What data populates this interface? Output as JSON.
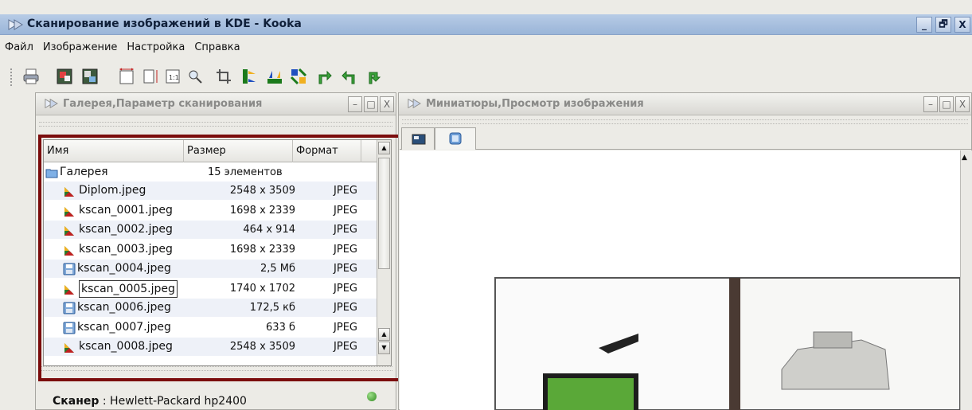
{
  "window": {
    "title": "Сканирование изображений в KDE - Kooka",
    "btn_min": "_",
    "btn_max": "🗗",
    "btn_close": "X"
  },
  "menu": {
    "file": "Файл",
    "image": "Изображение",
    "settings": "Настройка",
    "help": "Справка"
  },
  "toolbar_icons": [
    "print-icon",
    "scan-icon",
    "scan-preview-icon",
    "fit-width-icon",
    "fit-height-icon",
    "original-size-icon",
    "zoom-icon",
    "crop-icon",
    "mirror-vertical-icon",
    "mirror-horizontal-icon",
    "mirror-both-icon",
    "rotate-cw-icon",
    "rotate-ccw-icon",
    "rotate-180-icon"
  ],
  "left_panel": {
    "title": "Галерея,Параметр сканирования",
    "btn_min": "–",
    "btn_max": "□",
    "btn_close": "X"
  },
  "right_panel": {
    "title": "Миниатюры,Просмотр изображения",
    "btn_min": "–",
    "btn_max": "□",
    "btn_close": "X"
  },
  "gallery": {
    "columns": [
      "Имя",
      "Размер",
      "Формат"
    ],
    "root": {
      "name": "Галерея",
      "size": "15 элементов"
    },
    "rows": [
      {
        "name": "Diplom.jpeg",
        "size": "2548 x 3509",
        "format": "JPEG",
        "icon": "image-icon"
      },
      {
        "name": "kscan_0001.jpeg",
        "size": "1698 x 2339",
        "format": "JPEG",
        "icon": "image-icon"
      },
      {
        "name": "kscan_0002.jpeg",
        "size": "464 x 914",
        "format": "JPEG",
        "icon": "image-icon"
      },
      {
        "name": "kscan_0003.jpeg",
        "size": "1698 x 2339",
        "format": "JPEG",
        "icon": "image-icon"
      },
      {
        "name": "kscan_0004.jpeg",
        "size": "2,5 Мб",
        "format": "JPEG",
        "icon": "disk-icon"
      },
      {
        "name": "kscan_0005.jpeg",
        "size": "1740 x 1702",
        "format": "JPEG",
        "icon": "image-icon",
        "selected": true
      },
      {
        "name": "kscan_0006.jpeg",
        "size": "172,5 кб",
        "format": "JPEG",
        "icon": "disk-icon"
      },
      {
        "name": "kscan_0007.jpeg",
        "size": "633 б",
        "format": "JPEG",
        "icon": "disk-icon"
      },
      {
        "name": "kscan_0008.jpeg",
        "size": "2548 x 3509",
        "format": "JPEG",
        "icon": "image-icon"
      }
    ]
  },
  "scanner": {
    "label": "Сканер",
    "sep": " : ",
    "value": "Hewlett-Packard hp2400"
  },
  "colors": {
    "accent_frame": "#7b0d0d",
    "titlebar": "#9ab5d8",
    "status_led": "#2f8a1f"
  }
}
